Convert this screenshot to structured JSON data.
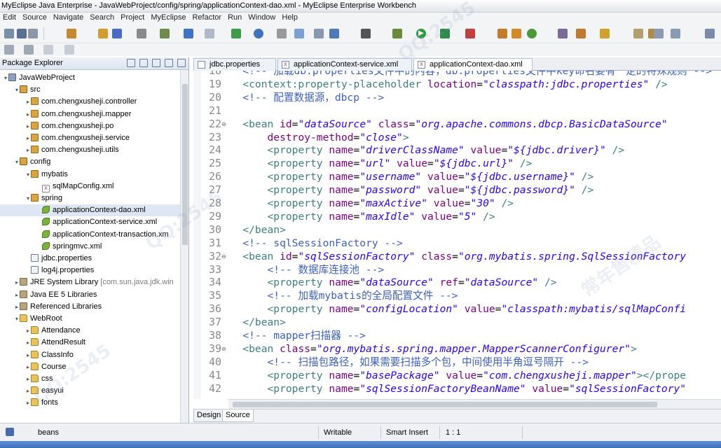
{
  "window": {
    "title": "MyEclipse Java Enterprise - JavaWebProject/config/spring/applicationContext-dao.xml - MyEclipse Enterprise Workbench"
  },
  "menu": [
    "Edit",
    "Source",
    "Navigate",
    "Search",
    "Project",
    "MyEclipse",
    "Refactor",
    "Run",
    "Window",
    "Help"
  ],
  "package_explorer": {
    "title": "Package Explorer",
    "items": [
      {
        "label": "JavaWebProject",
        "icon": "project-icon",
        "tw": "▾",
        "indent": 0
      },
      {
        "label": "src",
        "icon": "source-folder-icon",
        "tw": "▾",
        "indent": 1
      },
      {
        "label": "com.chengxusheji.controller",
        "icon": "package-icon",
        "tw": "▸",
        "indent": 2
      },
      {
        "label": "com.chengxusheji.mapper",
        "icon": "package-icon",
        "tw": "▸",
        "indent": 2
      },
      {
        "label": "com.chengxusheji.po",
        "icon": "package-icon",
        "tw": "▸",
        "indent": 2
      },
      {
        "label": "com.chengxusheji.service",
        "icon": "package-icon",
        "tw": "▸",
        "indent": 2
      },
      {
        "label": "com.chengxusheji.utils",
        "icon": "package-icon",
        "tw": "▸",
        "indent": 2
      },
      {
        "label": "config",
        "icon": "source-folder-icon",
        "tw": "▾",
        "indent": 1
      },
      {
        "label": "mybatis",
        "icon": "package-icon",
        "tw": "▾",
        "indent": 2
      },
      {
        "label": "sqlMapConfig.xml",
        "icon": "xml-file-icon",
        "tw": "",
        "indent": 3
      },
      {
        "label": "spring",
        "icon": "package-icon",
        "tw": "▾",
        "indent": 2
      },
      {
        "label": "applicationContext-dao.xml",
        "icon": "spring-file-icon",
        "tw": "",
        "indent": 3,
        "selected": true
      },
      {
        "label": "applicationContext-service.xml",
        "icon": "spring-file-icon",
        "tw": "",
        "indent": 3
      },
      {
        "label": "applicationContext-transaction.xm",
        "icon": "spring-file-icon",
        "tw": "",
        "indent": 3
      },
      {
        "label": "springmvc.xml",
        "icon": "spring-file-icon",
        "tw": "",
        "indent": 3
      },
      {
        "label": "jdbc.properties",
        "icon": "properties-file-icon",
        "tw": "",
        "indent": 2
      },
      {
        "label": "log4j.properties",
        "icon": "properties-file-icon",
        "tw": "",
        "indent": 2
      },
      {
        "label": "JRE System Library",
        "suffix": "[com.sun.java.jdk.win",
        "icon": "library-icon",
        "tw": "▸",
        "indent": 1
      },
      {
        "label": "Java EE 5 Libraries",
        "icon": "library-icon",
        "tw": "▸",
        "indent": 1
      },
      {
        "label": "Referenced Libraries",
        "icon": "library-icon",
        "tw": "▸",
        "indent": 1
      },
      {
        "label": "WebRoot",
        "icon": "folder-icon",
        "tw": "▾",
        "indent": 1
      },
      {
        "label": "Attendance",
        "icon": "folder-icon",
        "tw": "▸",
        "indent": 2
      },
      {
        "label": "AttendResult",
        "icon": "folder-icon",
        "tw": "▸",
        "indent": 2
      },
      {
        "label": "ClassInfo",
        "icon": "folder-icon",
        "tw": "▸",
        "indent": 2
      },
      {
        "label": "Course",
        "icon": "folder-icon",
        "tw": "▸",
        "indent": 2
      },
      {
        "label": "css",
        "icon": "folder-icon",
        "tw": "▸",
        "indent": 2
      },
      {
        "label": "easyui",
        "icon": "folder-icon",
        "tw": "▸",
        "indent": 2
      },
      {
        "label": "fonts",
        "icon": "folder-icon",
        "tw": "▸",
        "indent": 2
      }
    ]
  },
  "editor_tabs": [
    {
      "label": "jdbc.properties",
      "active": false
    },
    {
      "label": "applicationContext-service.xml",
      "active": false
    },
    {
      "label": "applicationContext-dao.xml",
      "active": true
    }
  ],
  "code_lines": [
    {
      "n": "18",
      "segs": [
        [
          "   ",
          ""
        ],
        [
          "<!-- 加载db.properties文件中的内容，db.properties文件中key命名要有一定的特殊规则 -->",
          "c"
        ]
      ]
    },
    {
      "n": "19",
      "segs": [
        [
          "   ",
          ""
        ],
        [
          "<context:property-placeholder",
          "t"
        ],
        [
          " ",
          ""
        ],
        [
          "location",
          "a"
        ],
        [
          "=",
          ""
        ],
        [
          "\"classpath:jdbc.properties\"",
          "v"
        ],
        [
          " />",
          "t"
        ]
      ]
    },
    {
      "n": "20",
      "segs": [
        [
          "   ",
          ""
        ],
        [
          "<!-- 配置数据源，dbcp -->",
          "c"
        ]
      ]
    },
    {
      "n": "21",
      "segs": [
        [
          "",
          ""
        ]
      ]
    },
    {
      "n": "22",
      "fold": "⊖",
      "segs": [
        [
          "   ",
          ""
        ],
        [
          "<bean",
          "t"
        ],
        [
          " ",
          ""
        ],
        [
          "id",
          "a"
        ],
        [
          "=",
          ""
        ],
        [
          "\"dataSource\"",
          "v"
        ],
        [
          " ",
          ""
        ],
        [
          "class",
          "a"
        ],
        [
          "=",
          ""
        ],
        [
          "\"org.apache.commons.dbcp.BasicDataSource\"",
          "v"
        ]
      ]
    },
    {
      "n": "23",
      "segs": [
        [
          "       ",
          ""
        ],
        [
          "destroy-method",
          "a"
        ],
        [
          "=",
          ""
        ],
        [
          "\"close\"",
          "v"
        ],
        [
          ">",
          "t"
        ]
      ]
    },
    {
      "n": "24",
      "segs": [
        [
          "       ",
          ""
        ],
        [
          "<property",
          "t"
        ],
        [
          " ",
          ""
        ],
        [
          "name",
          "a"
        ],
        [
          "=",
          ""
        ],
        [
          "\"driverClassName\"",
          "v"
        ],
        [
          " ",
          ""
        ],
        [
          "value",
          "a"
        ],
        [
          "=",
          ""
        ],
        [
          "\"${jdbc.driver}\"",
          "v"
        ],
        [
          " />",
          "t"
        ]
      ]
    },
    {
      "n": "25",
      "segs": [
        [
          "       ",
          ""
        ],
        [
          "<property",
          "t"
        ],
        [
          " ",
          ""
        ],
        [
          "name",
          "a"
        ],
        [
          "=",
          ""
        ],
        [
          "\"url\"",
          "v"
        ],
        [
          " ",
          ""
        ],
        [
          "value",
          "a"
        ],
        [
          "=",
          ""
        ],
        [
          "\"${jdbc.url}\"",
          "v"
        ],
        [
          " />",
          "t"
        ]
      ]
    },
    {
      "n": "26",
      "segs": [
        [
          "       ",
          ""
        ],
        [
          "<property",
          "t"
        ],
        [
          " ",
          ""
        ],
        [
          "name",
          "a"
        ],
        [
          "=",
          ""
        ],
        [
          "\"username\"",
          "v"
        ],
        [
          " ",
          ""
        ],
        [
          "value",
          "a"
        ],
        [
          "=",
          ""
        ],
        [
          "\"${jdbc.username}\"",
          "v"
        ],
        [
          " />",
          "t"
        ]
      ]
    },
    {
      "n": "27",
      "segs": [
        [
          "       ",
          ""
        ],
        [
          "<property",
          "t"
        ],
        [
          " ",
          ""
        ],
        [
          "name",
          "a"
        ],
        [
          "=",
          ""
        ],
        [
          "\"password\"",
          "v"
        ],
        [
          " ",
          ""
        ],
        [
          "value",
          "a"
        ],
        [
          "=",
          ""
        ],
        [
          "\"${jdbc.password}\"",
          "v"
        ],
        [
          " />",
          "t"
        ]
      ]
    },
    {
      "n": "28",
      "segs": [
        [
          "       ",
          ""
        ],
        [
          "<property",
          "t"
        ],
        [
          " ",
          ""
        ],
        [
          "name",
          "a"
        ],
        [
          "=",
          ""
        ],
        [
          "\"maxActive\"",
          "v"
        ],
        [
          " ",
          ""
        ],
        [
          "value",
          "a"
        ],
        [
          "=",
          ""
        ],
        [
          "\"30\"",
          "v"
        ],
        [
          " />",
          "t"
        ]
      ]
    },
    {
      "n": "29",
      "segs": [
        [
          "       ",
          ""
        ],
        [
          "<property",
          "t"
        ],
        [
          " ",
          ""
        ],
        [
          "name",
          "a"
        ],
        [
          "=",
          ""
        ],
        [
          "\"maxIdle\"",
          "v"
        ],
        [
          " ",
          ""
        ],
        [
          "value",
          "a"
        ],
        [
          "=",
          ""
        ],
        [
          "\"5\"",
          "v"
        ],
        [
          " />",
          "t"
        ]
      ]
    },
    {
      "n": "30",
      "segs": [
        [
          "   ",
          ""
        ],
        [
          "</bean>",
          "t"
        ]
      ]
    },
    {
      "n": "31",
      "segs": [
        [
          "   ",
          ""
        ],
        [
          "<!-- sqlSessionFactory -->",
          "c"
        ]
      ]
    },
    {
      "n": "32",
      "fold": "⊖",
      "segs": [
        [
          "   ",
          ""
        ],
        [
          "<bean",
          "t"
        ],
        [
          " ",
          ""
        ],
        [
          "id",
          "a"
        ],
        [
          "=",
          ""
        ],
        [
          "\"sqlSessionFactory\"",
          "v"
        ],
        [
          " ",
          ""
        ],
        [
          "class",
          "a"
        ],
        [
          "=",
          ""
        ],
        [
          "\"org.mybatis.spring.SqlSessionFactory",
          "v"
        ]
      ]
    },
    {
      "n": "33",
      "segs": [
        [
          "       ",
          ""
        ],
        [
          "<!-- 数据库连接池 -->",
          "c"
        ]
      ]
    },
    {
      "n": "34",
      "segs": [
        [
          "       ",
          ""
        ],
        [
          "<property",
          "t"
        ],
        [
          " ",
          ""
        ],
        [
          "name",
          "a"
        ],
        [
          "=",
          ""
        ],
        [
          "\"dataSource\"",
          "v"
        ],
        [
          " ",
          ""
        ],
        [
          "ref",
          "a"
        ],
        [
          "=",
          ""
        ],
        [
          "\"dataSource\"",
          "v"
        ],
        [
          " />",
          "t"
        ]
      ]
    },
    {
      "n": "35",
      "segs": [
        [
          "       ",
          ""
        ],
        [
          "<!-- 加载mybatis的全局配置文件 -->",
          "c"
        ]
      ]
    },
    {
      "n": "36",
      "segs": [
        [
          "       ",
          ""
        ],
        [
          "<property",
          "t"
        ],
        [
          " ",
          ""
        ],
        [
          "name",
          "a"
        ],
        [
          "=",
          ""
        ],
        [
          "\"configLocation\"",
          "v"
        ],
        [
          " ",
          ""
        ],
        [
          "value",
          "a"
        ],
        [
          "=",
          ""
        ],
        [
          "\"classpath:mybatis/sqlMapConfi",
          "v"
        ]
      ]
    },
    {
      "n": "37",
      "segs": [
        [
          "   ",
          ""
        ],
        [
          "</bean>",
          "t"
        ]
      ]
    },
    {
      "n": "38",
      "segs": [
        [
          "   ",
          ""
        ],
        [
          "<!-- mapper扫描器 -->",
          "c"
        ]
      ]
    },
    {
      "n": "39",
      "fold": "⊖",
      "segs": [
        [
          "   ",
          ""
        ],
        [
          "<bean",
          "t"
        ],
        [
          " ",
          ""
        ],
        [
          "class",
          "a"
        ],
        [
          "=",
          ""
        ],
        [
          "\"org.mybatis.spring.mapper.MapperScannerConfigurer\"",
          "v"
        ],
        [
          ">",
          "t"
        ]
      ]
    },
    {
      "n": "40",
      "segs": [
        [
          "       ",
          ""
        ],
        [
          "<!-- 扫描包路径，如果需要扫描多个包，中间使用半角逗号隔开 -->",
          "c"
        ]
      ]
    },
    {
      "n": "41",
      "segs": [
        [
          "       ",
          ""
        ],
        [
          "<property",
          "t"
        ],
        [
          " ",
          ""
        ],
        [
          "name",
          "a"
        ],
        [
          "=",
          ""
        ],
        [
          "\"basePackage\"",
          "v"
        ],
        [
          " ",
          ""
        ],
        [
          "value",
          "a"
        ],
        [
          "=",
          ""
        ],
        [
          "\"com.chengxusheji.mapper\"",
          "v"
        ],
        [
          "></prope",
          "t"
        ]
      ]
    },
    {
      "n": "42",
      "segs": [
        [
          "       ",
          ""
        ],
        [
          "<property",
          "t"
        ],
        [
          " ",
          ""
        ],
        [
          "name",
          "a"
        ],
        [
          "=",
          ""
        ],
        [
          "\"sqlSessionFactoryBeanName\"",
          "v"
        ],
        [
          " ",
          ""
        ],
        [
          "value",
          "a"
        ],
        [
          "=",
          ""
        ],
        [
          "\"sqlSessionFactory\"",
          "v"
        ]
      ]
    }
  ],
  "design_tabs": {
    "design": "Design",
    "source": "Source"
  },
  "status": {
    "left": "beans",
    "writable": "Writable",
    "insert": "Smart Insert",
    "position": "1 : 1"
  },
  "colors": {
    "tag": "#3f7f7f",
    "attr": "#7f007f",
    "value": "#2a00ff",
    "comment": "#3f5fbf"
  }
}
